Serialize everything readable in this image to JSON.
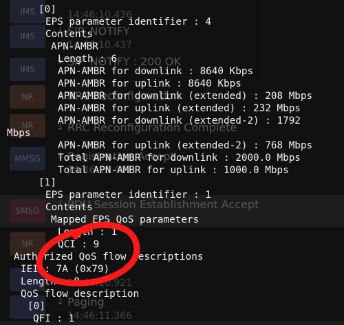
{
  "background_list": [
    {
      "badge": "IMS",
      "badge_color": "#3f4a78",
      "title": "",
      "time": "14:46:10.436",
      "selected": false
    },
    {
      "badge": "IMS",
      "badge_color": "#3f4a78",
      "title": "SIP_NOTIFY",
      "time": "14:46:10.437",
      "selected": false
    },
    {
      "badge": "IMS",
      "badge_color": "#3f4a78",
      "title": "SIP_NOTIFY : 200 OK",
      "time": "",
      "selected": false
    },
    {
      "badge": "NR",
      "badge_color": "#7a4a3a",
      "title": "RRC Reconfiguration",
      "time": "",
      "selected": false
    },
    {
      "badge": "NR",
      "badge_color": "#7a4a3a",
      "title": "RRC Reconfiguration Complete",
      "time": "",
      "selected": false
    },
    {
      "badge": "MMSG",
      "badge_color": "#3f4a78",
      "title": "Registration Accept",
      "time": "14:46:10.467",
      "selected": false
    },
    {
      "badge": "SMSG",
      "badge_color": "#7a3a4a",
      "title": "PDU Session Establishment Accept",
      "time": "",
      "selected": true
    },
    {
      "badge": "NR",
      "badge_color": "#7a4a3a",
      "title": "",
      "time": "",
      "selected": false
    },
    {
      "badge": "",
      "badge_color": "#3f4a78",
      "title": "",
      "time": "14:46:10.921",
      "selected": false
    },
    {
      "badge": "",
      "badge_color": "#3f4a78",
      "title": "Paging",
      "time": "14:46:11.366",
      "selected": false
    }
  ],
  "decode_lines": [
    "[0]",
    "EPS parameter identifier : 4",
    "Contents",
    "APN-AMBR",
    "Length : 6",
    "APN-AMBR for downlink : 8640 Kbps",
    "APN-AMBR for uplink : 8640 Kbps",
    "APN-AMBR for downlink (extended) : 208 Mbps",
    "APN-AMBR for uplink (extended) : 232 Mbps",
    "APN-AMBR for downlink (extended-2) : 1792",
    "Mbps",
    "APN-AMBR for uplink (extended-2) : 768 Mbps",
    "Total APN-AMBR for downlink : 2000.0 Mbps",
    "Total APN-AMBR for uplink : 1000.0 Mbps",
    "[1]",
    "EPS parameter identifier : 1",
    "Contents",
    "Mapped EPS QoS parameters",
    "Length : 1",
    "QCI : 9",
    "Authorized QoS flow descriptions",
    "IEI : 7A (0x79)",
    "Length : 9",
    "QoS flow description",
    "[0]",
    "QFI : 1"
  ],
  "annotation": {
    "shape": "hand-drawn circle",
    "color": "#ff1a1a",
    "target": "QCI : 9"
  }
}
